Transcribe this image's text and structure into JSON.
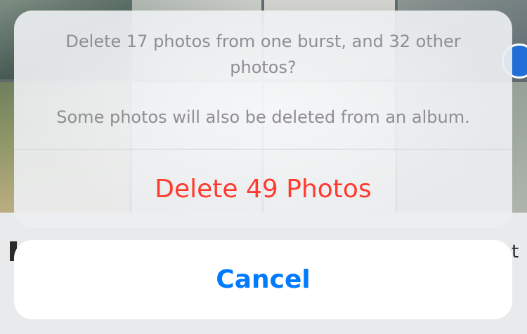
{
  "action_sheet": {
    "title": "Delete 17 photos from one burst, and 32 other photos?",
    "message": "Some photos will also be deleted from an album.",
    "destructive_label": "Delete 49 Photos",
    "cancel_label": "Cancel"
  },
  "colors": {
    "destructive": "#ff3b30",
    "cancel": "#007aff",
    "header_text": "#8e8e93"
  }
}
